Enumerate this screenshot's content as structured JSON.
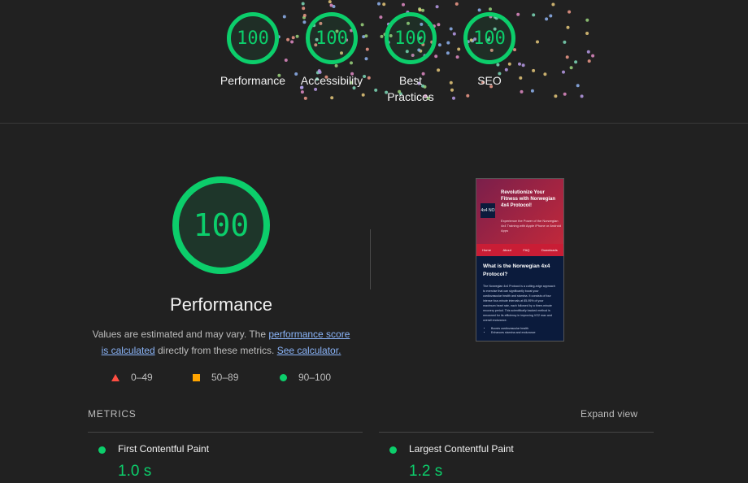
{
  "colors": {
    "background": "#212121",
    "pass": "#0cce6b",
    "average": "#ffa400",
    "fail": "#ff4e42",
    "link": "#8ab4f8"
  },
  "categories": [
    {
      "score": "100",
      "label": "Performance"
    },
    {
      "score": "100",
      "label": "Accessibility"
    },
    {
      "score": "100",
      "label": "Best Practices"
    },
    {
      "score": "100",
      "label": "SEO"
    }
  ],
  "performance": {
    "score": "100",
    "title": "Performance",
    "note_prefix": "Values are estimated and may vary. The ",
    "note_link1": "performance score is calculated",
    "note_middle": " directly from these metrics. ",
    "note_link2": "See calculator."
  },
  "legend": [
    {
      "icon": "triangle-icon",
      "range": "0–49"
    },
    {
      "icon": "square-icon",
      "range": "50–89"
    },
    {
      "icon": "circle-icon",
      "range": "90–100"
    }
  ],
  "screenshot": {
    "hero_title": "Revolutionize Your Fitness with Norwegian 4x4 Protocol!",
    "hero_subtitle": "Experience the Power of the Norwegian 4x4 Training with Apple iPhone or Android Apps",
    "logo_text": "4x4 NO",
    "nav": [
      "Home",
      "About",
      "FAQ",
      "Downloads"
    ],
    "section_title": "What is the Norwegian 4x4 Protocol?",
    "section_text": "The Norwegian 4x4 Protocol is a cutting-edge approach to exercise that can significantly boost your cardiovascular health and stamina. It consists of four intense four-minute intervals at 85-95% of your maximum heart rate, each followed by a three-minute recovery period. This scientifically backed method is renowned for its efficiency in improving VO2 max and overall endurance.",
    "bullets": [
      "Boosts cardiovascular health",
      "Enhances stamina and endurance"
    ]
  },
  "metrics": {
    "heading": "METRICS",
    "expand_label": "Expand view",
    "items": [
      {
        "name": "First Contentful Paint",
        "value": "1.0 s"
      },
      {
        "name": "Largest Contentful Paint",
        "value": "1.2 s"
      }
    ]
  }
}
